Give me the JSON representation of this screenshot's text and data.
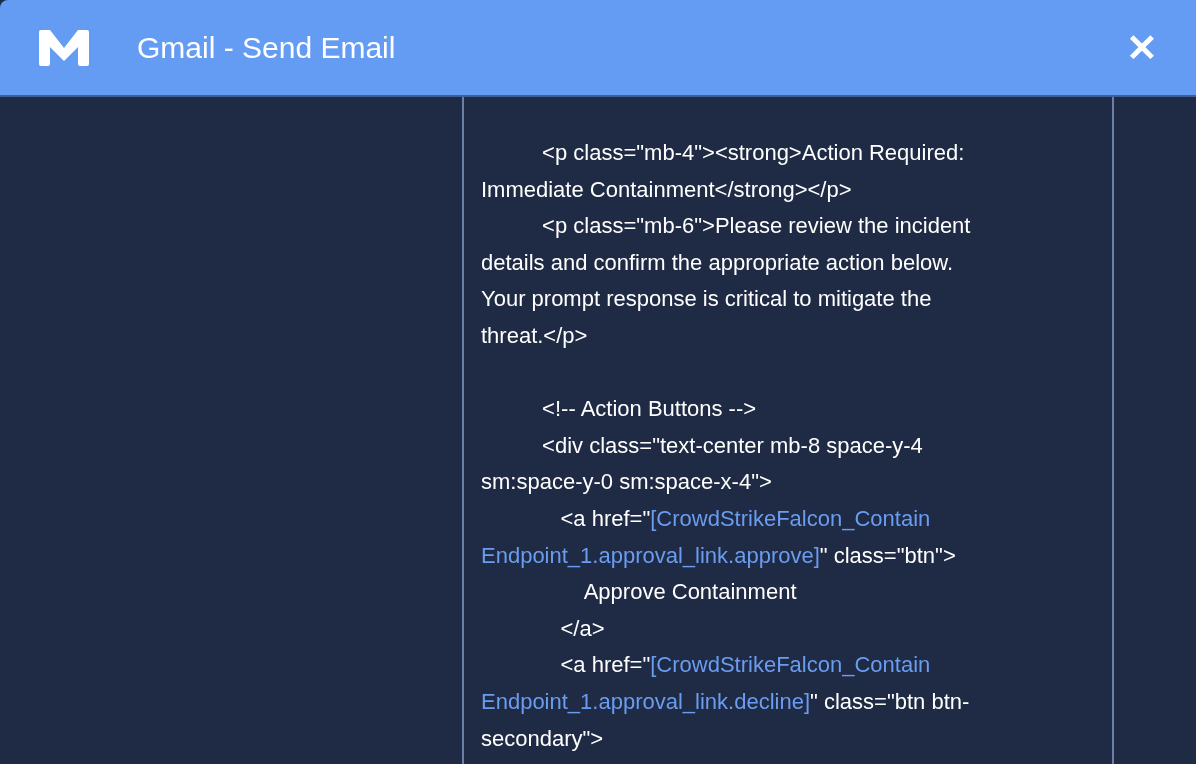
{
  "window": {
    "title": "Gmail - Send Email",
    "close": "✕"
  },
  "code_lines": [
    {
      "kind": "code",
      "segments": [
        {
          "kind": "text",
          "text": "          <p class=\"mb-4\"><strong>Action Required:"
        }
      ]
    },
    {
      "kind": "code",
      "segments": [
        {
          "kind": "text",
          "text": "Immediate Containment</strong></p>"
        }
      ]
    },
    {
      "kind": "code",
      "segments": [
        {
          "kind": "text",
          "text": "          <p class=\"mb-6\">Please review the incident"
        }
      ]
    },
    {
      "kind": "code",
      "segments": [
        {
          "kind": "text",
          "text": "details and confirm the appropriate action below."
        }
      ]
    },
    {
      "kind": "code",
      "segments": [
        {
          "kind": "text",
          "text": "Your prompt response is critical to mitigate the"
        }
      ]
    },
    {
      "kind": "code",
      "segments": [
        {
          "kind": "text",
          "text": "threat.</p>"
        }
      ]
    },
    {
      "kind": "blank"
    },
    {
      "kind": "code",
      "segments": [
        {
          "kind": "text",
          "text": "          <!-- Action Buttons -->"
        }
      ]
    },
    {
      "kind": "code",
      "segments": [
        {
          "kind": "text",
          "text": "          <div class=\"text-center mb-8 space-y-4"
        }
      ]
    },
    {
      "kind": "code",
      "segments": [
        {
          "kind": "text",
          "text": "sm:space-y-0 sm:space-x-4\">"
        }
      ]
    },
    {
      "kind": "code",
      "segments": [
        {
          "kind": "text",
          "text": "             <a href=\""
        },
        {
          "kind": "variable",
          "text": "[CrowdStrikeFalcon_Contain"
        }
      ]
    },
    {
      "kind": "code",
      "segments": [
        {
          "kind": "variable",
          "text": "Endpoint_1.approval_link.approve]"
        },
        {
          "kind": "text",
          "text": "\" class=\"btn\">"
        }
      ]
    },
    {
      "kind": "code",
      "segments": [
        {
          "kind": "text",
          "text": "                 Approve Containment"
        }
      ]
    },
    {
      "kind": "code",
      "segments": [
        {
          "kind": "text",
          "text": "             </a>"
        }
      ]
    },
    {
      "kind": "code",
      "segments": [
        {
          "kind": "text",
          "text": "             <a href=\""
        },
        {
          "kind": "variable",
          "text": "[CrowdStrikeFalcon_Contain"
        }
      ]
    },
    {
      "kind": "code",
      "segments": [
        {
          "kind": "variable",
          "text": "Endpoint_1.approval_link.decline]"
        },
        {
          "kind": "text",
          "text": "\" class=\"btn btn-"
        }
      ]
    },
    {
      "kind": "code",
      "segments": [
        {
          "kind": "text",
          "text": "secondary\">"
        }
      ]
    }
  ]
}
